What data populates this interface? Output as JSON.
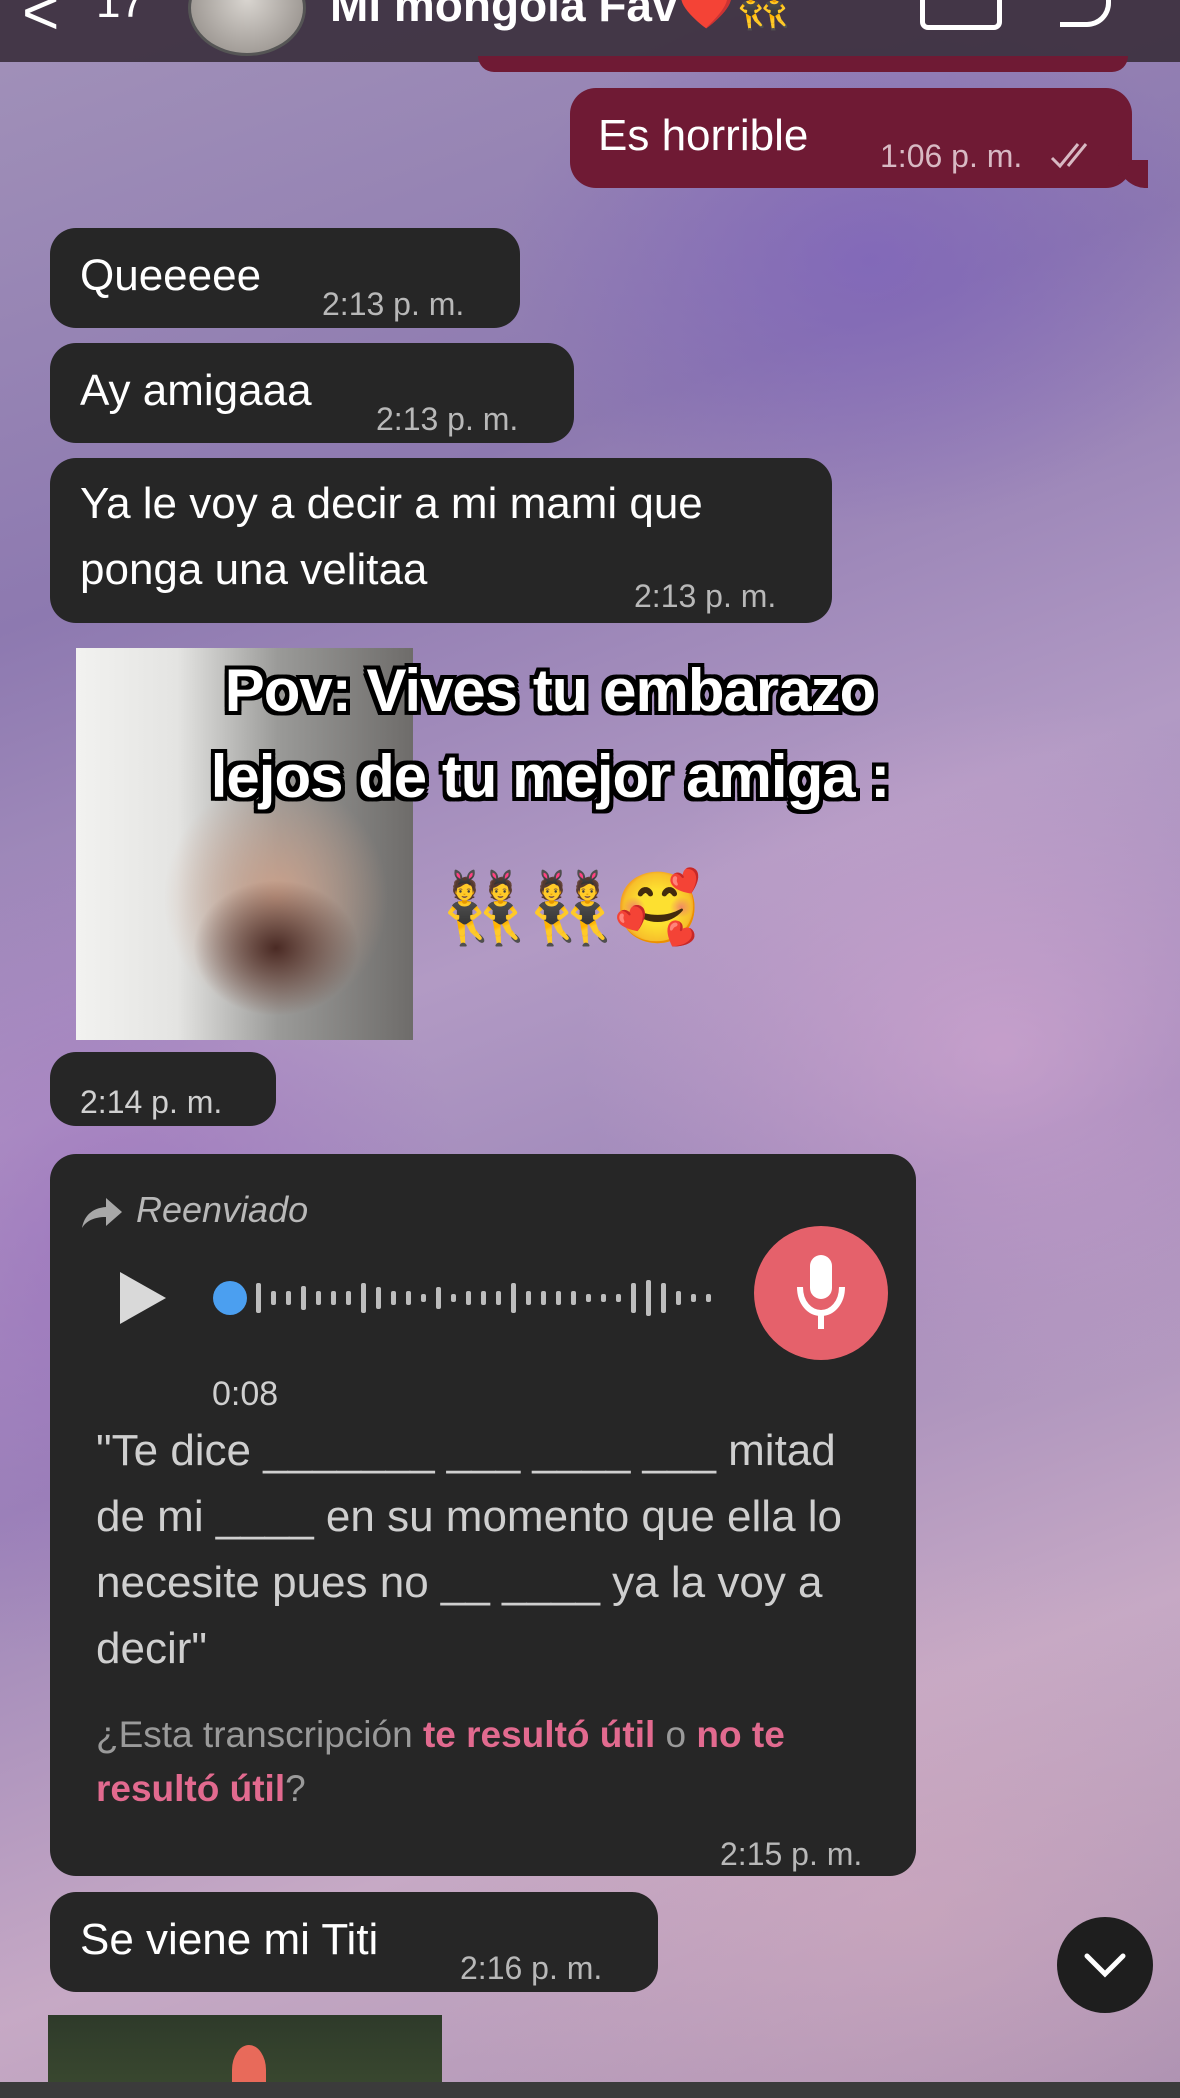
{
  "header": {
    "back_glyph": "<",
    "unread_count": "17",
    "contact_name": "Mi mongola Fav❤️👯",
    "icons": [
      "back-icon",
      "avatar",
      "video-call-icon",
      "phone-icon"
    ]
  },
  "messages": {
    "m1": {
      "text": "Es horrible",
      "time": "1:06 p. m."
    },
    "m2": {
      "text": "Queeeee",
      "time": "2:13 p. m."
    },
    "m3": {
      "text": "Ay amigaaa",
      "time": "2:13 p. m."
    },
    "m4": {
      "line1": "Ya le voy a decir a mi mami que",
      "line2": "ponga una velitaa",
      "time": "2:13 p. m."
    },
    "media_time": "2:14 p. m.",
    "voice": {
      "forwarded_label": "Reenviado",
      "duration": "0:08",
      "transcript": "\"Te dice _______ ___ ____ ___ mitad de mi ____ en su momento que ella lo necesite pues no __ ____ ya la voy a decir\"",
      "feedback_prefix": "¿Esta transcripción ",
      "feedback_yes": "te resultó útil",
      "feedback_or": " o ",
      "feedback_no": "no te resultó útil",
      "feedback_suffix": "?",
      "time": "2:15 p. m."
    },
    "m5": {
      "text": "Se viene mi Titi",
      "time": "2:16 p. m."
    }
  },
  "overlay": {
    "line1": "Pov: Vives tu embarazo",
    "line2": "lejos de tu mejor amiga :",
    "emojis": "👯👯🥰"
  },
  "colors": {
    "incoming_bubble": "#262626",
    "outgoing_bubble": "#6f1a34",
    "accent_pink": "#e26a8f",
    "mic_button": "#e5616b"
  }
}
